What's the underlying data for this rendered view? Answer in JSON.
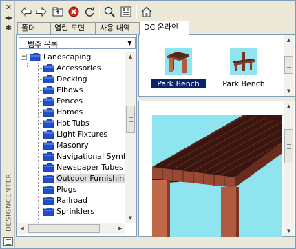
{
  "window": {
    "side_title": "DESIGNCENTER"
  },
  "toolbar": {
    "buttons": [
      "back-icon",
      "forward-icon",
      "up-icon",
      "stop-icon",
      "refresh-icon",
      "search-icon",
      "favorites-icon",
      "home-icon"
    ]
  },
  "tabs": [
    {
      "label": "폴더",
      "active": false
    },
    {
      "label": "열린 도면",
      "active": false
    },
    {
      "label": "사용 내역",
      "active": false
    },
    {
      "label": "DC 온라인",
      "active": true
    }
  ],
  "left_pane": {
    "dropdown_label": "범주 목록",
    "tree": {
      "root": "Landscaping",
      "children": [
        {
          "label": "Accessories",
          "selected": false
        },
        {
          "label": "Decking",
          "selected": false
        },
        {
          "label": "Elbows",
          "selected": false
        },
        {
          "label": "Fences",
          "selected": false
        },
        {
          "label": "Homes",
          "selected": false
        },
        {
          "label": "Hot Tubs",
          "selected": false
        },
        {
          "label": "Light Fixtures",
          "selected": false
        },
        {
          "label": "Masonry",
          "selected": false
        },
        {
          "label": "Navigational Symbols",
          "selected": false
        },
        {
          "label": "Newspaper Tubes",
          "selected": false
        },
        {
          "label": "Outdoor Furnishings",
          "selected": true
        },
        {
          "label": "Plugs",
          "selected": false
        },
        {
          "label": "Railroad",
          "selected": false
        },
        {
          "label": "Sprinklers",
          "selected": false
        }
      ]
    }
  },
  "content": {
    "items": [
      {
        "label": "Park Bench",
        "selected": true
      },
      {
        "label": "Park Bench",
        "selected": false
      }
    ]
  },
  "colors": {
    "selection": "#0a246a",
    "preview_background": "#8ee4ef",
    "folder_blue": "#1f4fcf",
    "bench_wood": "#b3573a"
  }
}
